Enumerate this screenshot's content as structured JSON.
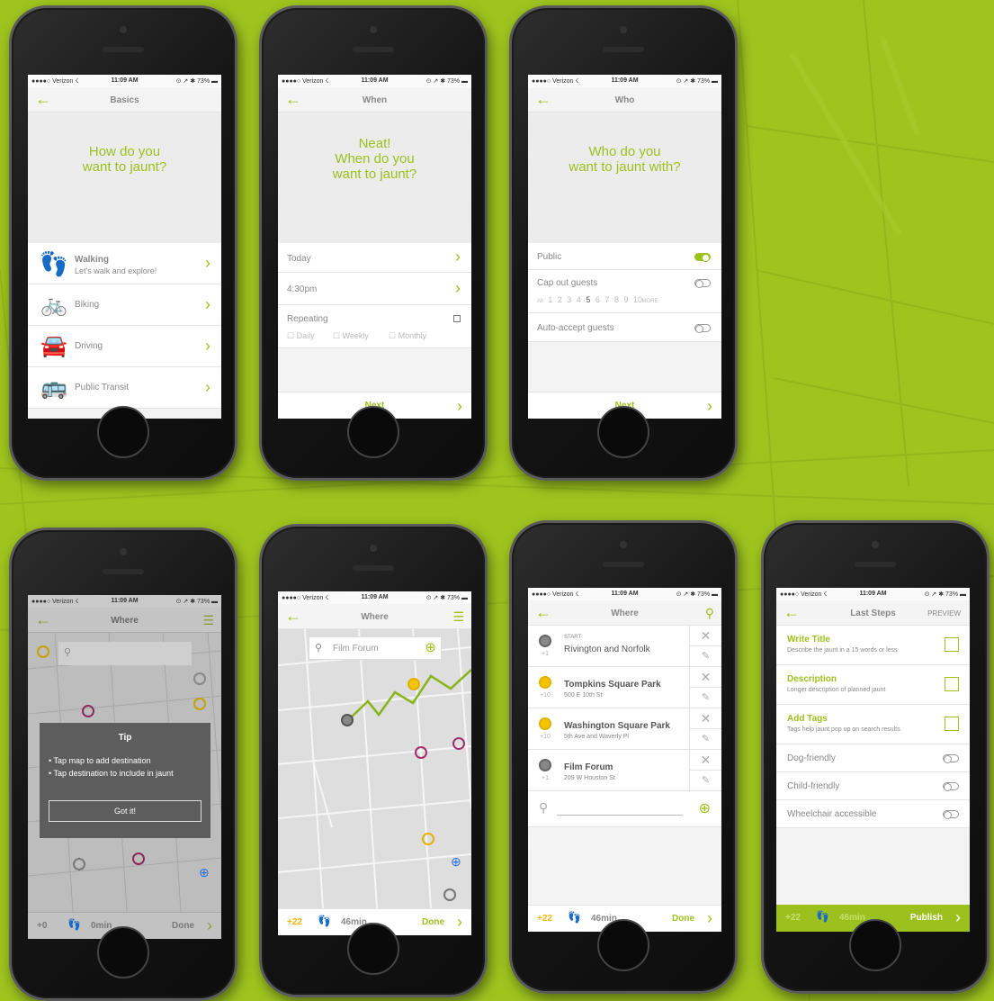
{
  "status": {
    "carrier": "●●●●○ Verizon ☇",
    "time": "11:09 AM",
    "battery": "⊙ ↗ ✱ 73% ▬"
  },
  "screens": {
    "basics": {
      "title": "Basics",
      "question": "How do you\nwant to jaunt?",
      "options": [
        {
          "label": "Walking",
          "sub": "Let's walk and explore!",
          "icon": "footprints-icon"
        },
        {
          "label": "Biking",
          "sub": "",
          "icon": "bike-icon"
        },
        {
          "label": "Driving",
          "sub": "",
          "icon": "car-icon"
        },
        {
          "label": "Public Transit",
          "sub": "",
          "icon": "bus-icon"
        }
      ]
    },
    "when": {
      "title": "When",
      "question": "Neat!\nWhen do you\nwant to jaunt?",
      "today": "Today",
      "time": "4:30pm",
      "repeating": "Repeating",
      "freq": [
        "Daily",
        "Weekly",
        "Monthly"
      ],
      "next": "Next"
    },
    "who": {
      "title": "Who",
      "question": "Who do you\nwant to jaunt with?",
      "public": "Public",
      "cap": "Cap out guests",
      "cap_values": [
        "All",
        "1",
        "2",
        "3",
        "4",
        "5",
        "6",
        "7",
        "8",
        "9",
        "10",
        "MORE"
      ],
      "cap_selected": "5",
      "auto": "Auto-accept guests",
      "next": "Next"
    },
    "where_tip": {
      "title": "Where",
      "tip_title": "Tip",
      "tips": [
        "Tap map to add destination",
        "Tap destination to include in jaunt"
      ],
      "got_it": "Got it!",
      "plus": "+0",
      "minutes": "0min",
      "done": "Done"
    },
    "where_map": {
      "title": "Where",
      "search_placeholder": "Film Forum",
      "plus": "+22",
      "minutes": "46min",
      "done": "Done"
    },
    "where_list": {
      "title": "Where",
      "stops": [
        {
          "tag": "START",
          "name": "Rivington and Norfolk",
          "addr": "",
          "count": "+1",
          "color": "#888888"
        },
        {
          "tag": "",
          "name": "Tompkins Square Park",
          "addr": "500 E 10th St",
          "count": "+10",
          "color": "#f5c400"
        },
        {
          "tag": "",
          "name": "Washington Square Park",
          "addr": "5th Ave and Waverly Pl",
          "count": "+10",
          "color": "#f5c400"
        },
        {
          "tag": "",
          "name": "Film Forum",
          "addr": "209 W Houston St",
          "count": "+1",
          "color": "#888888"
        }
      ],
      "plus": "+22",
      "minutes": "46min",
      "done": "Done"
    },
    "last_steps": {
      "title": "Last Steps",
      "preview": "PREVIEW",
      "steps": [
        {
          "title": "Write Title",
          "desc": "Describe the jaunt in a 15 words or less"
        },
        {
          "title": "Description",
          "desc": "Longer description of planned jaunt"
        },
        {
          "title": "Add Tags",
          "desc": "Tags help jaunt pop up on search results"
        }
      ],
      "toggles": [
        "Dog-friendly",
        "Child-friendly",
        "Wheelchair accessible"
      ],
      "plus": "+22",
      "minutes": "46min",
      "publish": "Publish"
    }
  },
  "colors": {
    "accent": "#9cc01e",
    "background": "#9fc41f",
    "purple": "#a0306a",
    "yellow": "#f5c400"
  }
}
